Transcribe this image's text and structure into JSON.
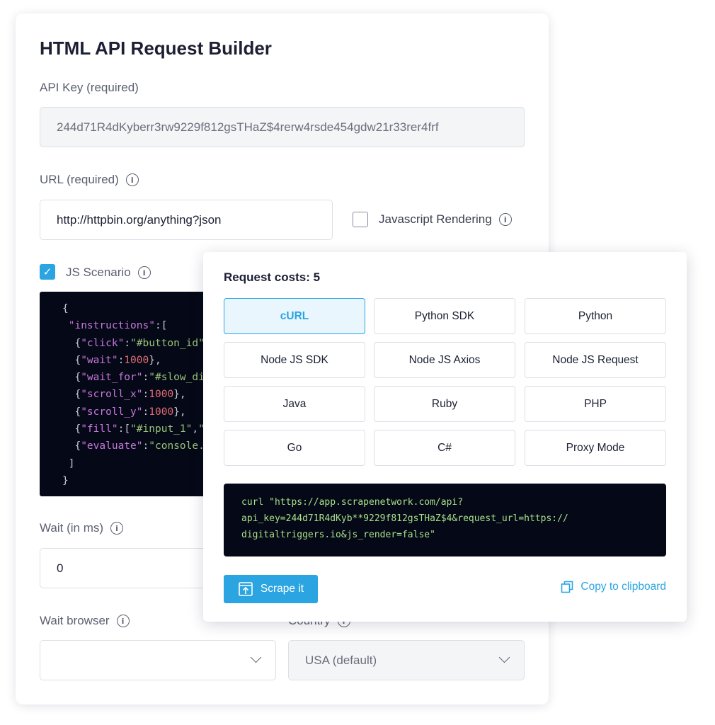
{
  "builder": {
    "title": "HTML API Request Builder",
    "api_key": {
      "label": "API Key (required)",
      "value": "244d71R4dKyberr3rw9229f812gsTHaZ$4rerw4rsde454gdw21r33rer4frf"
    },
    "url": {
      "label": "URL (required)",
      "value": "http://httpbin.org/anything?json"
    },
    "js_rendering": {
      "label": "Javascript Rendering",
      "checked": false
    },
    "js_scenario": {
      "label": "JS Scenario",
      "checked": true
    },
    "wait": {
      "label": "Wait (in ms)",
      "value": "0"
    },
    "wait_browser": {
      "label": "Wait browser",
      "value": ""
    },
    "country": {
      "label": "Country",
      "value": "USA (default)"
    }
  },
  "scenario_code": [
    "{",
    " \"instructions\":[",
    "  {\"click\":\"#button_id\"",
    "  {\"wait\":1000},",
    "  {\"wait_for\":\"#slow_di",
    "  {\"scroll_x\":1000},",
    "  {\"scroll_y\":1000},",
    "  {\"fill\":[\"#input_1\",\"",
    "  {\"evaluate\":\"console.",
    " ]",
    "}"
  ],
  "popup": {
    "title": "Request costs: 5",
    "languages": [
      "cURL",
      "Python SDK",
      "Python",
      "Node JS SDK",
      "Node JS Axios",
      "Node JS Request",
      "Java",
      "Ruby",
      "PHP",
      "Go",
      "C#",
      "Proxy Mode"
    ],
    "active_language": "cURL",
    "code_lines": [
      "curl \"https://app.scrapenetwork.com/api?",
      "api_key=244d71R4dKyb**9229f812gsTHaZ$4&request_url=https://",
      "digitaltriggers.io&js_render=false\""
    ],
    "scrape_label": "Scrape it",
    "copy_label": "Copy to clipboard"
  },
  "colors": {
    "accent": "#2aa5e2",
    "code_bg": "#050816",
    "text": "#1c2033",
    "muted": "#5c6170"
  },
  "icons": {
    "info": "info-circle-icon",
    "check": "checkmark-icon",
    "chevron": "chevron-down-icon",
    "scrape": "upload-box-icon",
    "copy": "copy-icon"
  }
}
